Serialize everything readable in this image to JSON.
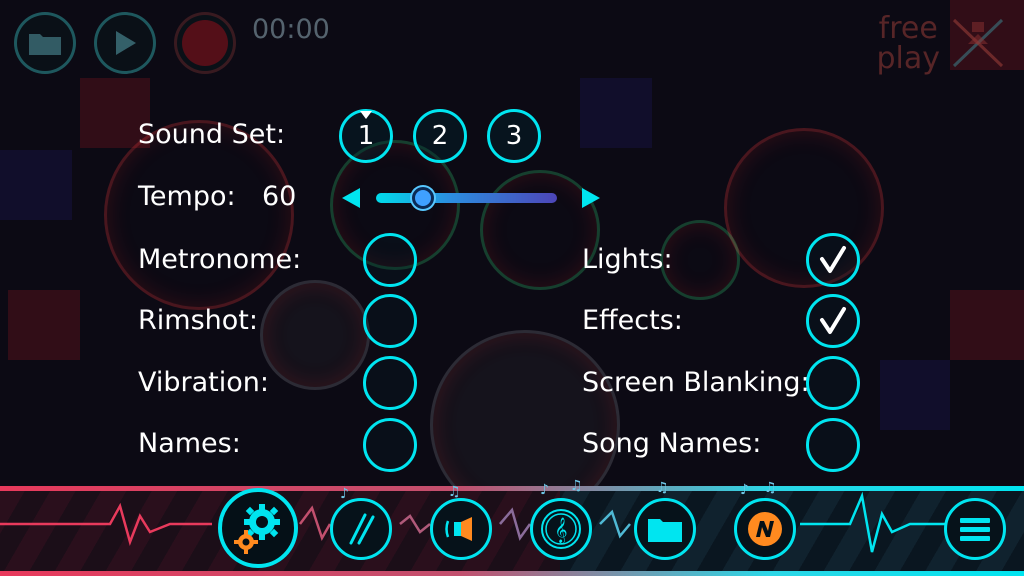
{
  "top_bar": {
    "timer": "00:00",
    "mode_line1": "free",
    "mode_line2": "play"
  },
  "settings": {
    "sound_set_label": "Sound Set:",
    "sound_set_options": [
      "1",
      "2",
      "3"
    ],
    "sound_set_selected": "1",
    "tempo_label": "Tempo:",
    "tempo_value": "60",
    "tempo_slider_fraction": 0.2,
    "left_toggles": [
      {
        "label": "Metronome:",
        "checked": false
      },
      {
        "label": "Rimshot:",
        "checked": false
      },
      {
        "label": "Vibration:",
        "checked": false
      },
      {
        "label": "Names:",
        "checked": false
      }
    ],
    "right_toggles": [
      {
        "label": "Lights:",
        "checked": true
      },
      {
        "label": "Effects:",
        "checked": true
      },
      {
        "label": "Screen Blanking:",
        "checked": false
      },
      {
        "label": "Song Names:",
        "checked": false
      }
    ]
  },
  "bottom_nav": {
    "items": [
      {
        "icon": "gears-icon",
        "active": true
      },
      {
        "icon": "drumsticks-icon",
        "active": false
      },
      {
        "icon": "speaker-icon",
        "active": false
      },
      {
        "icon": "treble-clef-icon",
        "active": false
      },
      {
        "icon": "folder-icon",
        "active": false
      },
      {
        "icon": "n-logo-icon",
        "active": false
      },
      {
        "icon": "menu-icon",
        "active": false
      }
    ]
  },
  "colors": {
    "accent": "#00e5f0",
    "rail_red": "#e83a5c",
    "orange": "#ff8a1f",
    "checkmark": "#ffffff"
  }
}
